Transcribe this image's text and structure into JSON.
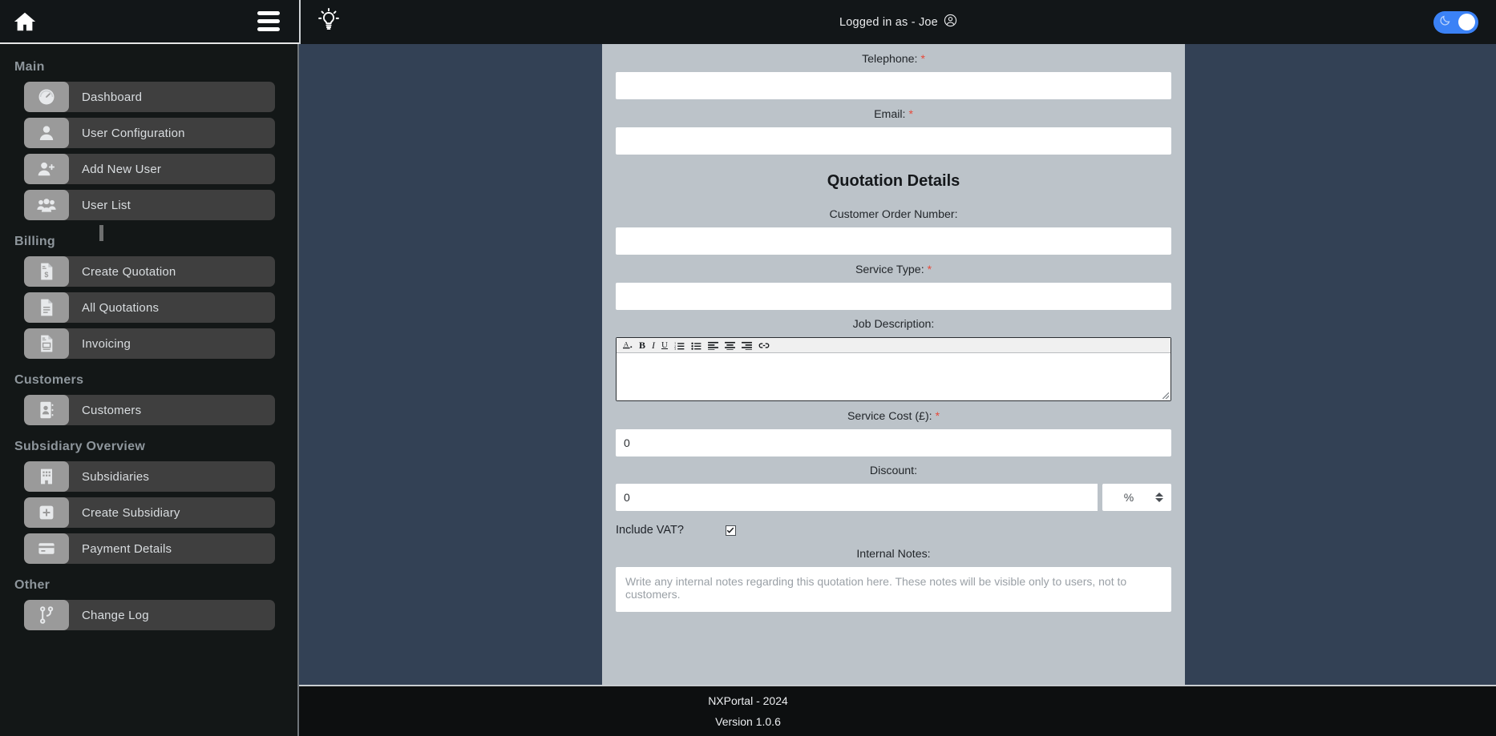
{
  "header": {
    "home_icon": "home-icon",
    "menu_icon": "hamburger-menu-icon",
    "bulb_icon": "lightbulb-icon",
    "logged_in_text": "Logged in as - Joe",
    "user_icon": "user-circle-icon",
    "theme_toggle": {
      "icon": "moon-icon",
      "state": "on",
      "accent": "#3b82f6"
    }
  },
  "sidebar": {
    "groups": [
      {
        "title": "Main",
        "items": [
          {
            "label": "Dashboard",
            "icon": "gauge-icon"
          },
          {
            "label": "User Configuration",
            "icon": "user-icon"
          },
          {
            "label": "Add New User",
            "icon": "user-plus-icon"
          },
          {
            "label": "User List",
            "icon": "users-group-icon"
          }
        ]
      },
      {
        "title": "Billing",
        "items": [
          {
            "label": "Create Quotation",
            "icon": "file-dollar-icon"
          },
          {
            "label": "All Quotations",
            "icon": "file-lines-icon"
          },
          {
            "label": "Invoicing",
            "icon": "file-invoice-icon"
          }
        ]
      },
      {
        "title": "Customers",
        "items": [
          {
            "label": "Customers",
            "icon": "address-book-icon"
          }
        ]
      },
      {
        "title": "Subsidiary Overview",
        "items": [
          {
            "label": "Subsidiaries",
            "icon": "building-icon"
          },
          {
            "label": "Create Subsidiary",
            "icon": "plus-square-icon"
          },
          {
            "label": "Payment Details",
            "icon": "credit-card-icon"
          }
        ]
      },
      {
        "title": "Other",
        "items": [
          {
            "label": "Change Log",
            "icon": "code-branch-icon"
          }
        ]
      }
    ]
  },
  "form": {
    "telephone": {
      "label": "Telephone:",
      "required": "*",
      "value": "",
      "placeholder": ""
    },
    "email": {
      "label": "Email:",
      "required": "*",
      "value": "",
      "placeholder": ""
    },
    "section_title": "Quotation Details",
    "customer_order_number": {
      "label": "Customer Order Number:",
      "value": "",
      "placeholder": ""
    },
    "service_type": {
      "label": "Service Type:",
      "required": "*",
      "value": "",
      "placeholder": ""
    },
    "job_description": {
      "label": "Job Description:",
      "value": "",
      "toolbar": [
        {
          "name": "text-color-icon",
          "glyph": "A"
        },
        {
          "name": "bold-icon",
          "glyph": "B"
        },
        {
          "name": "italic-icon",
          "glyph": "I"
        },
        {
          "name": "underline-icon",
          "glyph": "U"
        },
        {
          "name": "ordered-list-icon",
          "glyph": ""
        },
        {
          "name": "unordered-list-icon",
          "glyph": ""
        },
        {
          "name": "align-left-icon",
          "glyph": ""
        },
        {
          "name": "align-center-icon",
          "glyph": ""
        },
        {
          "name": "align-right-icon",
          "glyph": ""
        },
        {
          "name": "link-icon",
          "glyph": ""
        }
      ]
    },
    "service_cost": {
      "label": "Service Cost (£):",
      "required": "*",
      "value": "0"
    },
    "discount": {
      "label": "Discount:",
      "value": "0",
      "unit": "%"
    },
    "include_vat": {
      "label": "Include VAT?",
      "checked": true
    },
    "internal_notes": {
      "label": "Internal Notes:",
      "value": "",
      "placeholder": "Write any internal notes regarding this quotation here. These notes will be visible only to users, not to customers."
    }
  },
  "footer": {
    "line1": "NXPortal - 2024",
    "line2": "Version 1.0.6"
  }
}
